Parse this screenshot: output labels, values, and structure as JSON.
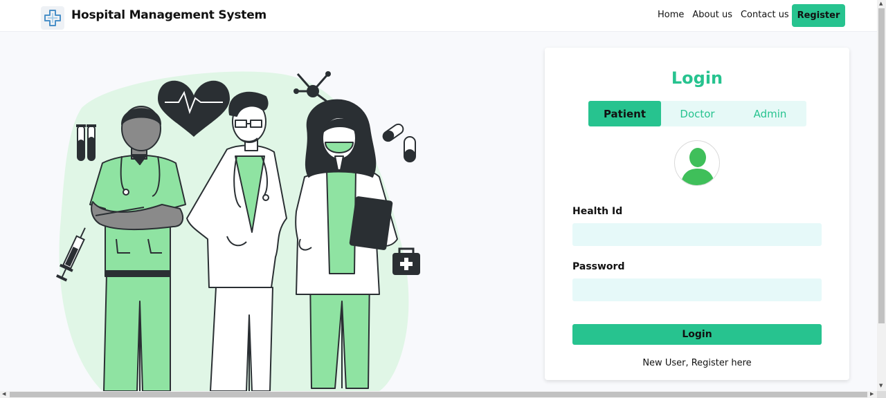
{
  "navbar": {
    "brand_title": "Hospital Management System",
    "links": [
      "Home",
      "About us",
      "Contact us"
    ],
    "register_label": "Register"
  },
  "login": {
    "title": "Login",
    "tabs": [
      "Patient",
      "Doctor",
      "Admin"
    ],
    "active_tab": "Patient",
    "fields": {
      "health_id_label": "Health Id",
      "health_id_value": "",
      "password_label": "Password",
      "password_value": ""
    },
    "submit_label": "Login",
    "register_link": "New User, Register here"
  },
  "icons": {
    "brand": "medical-cross-icon",
    "avatar": "user-silhouette-icon",
    "illustration": "medical-staff-illustration"
  },
  "colors": {
    "accent": "#27c38f",
    "input_bg": "#e6f9f9",
    "illustration_green": "#8fe3a2",
    "illustration_blob": "#e0f6e6",
    "dark": "#2a2f33"
  }
}
